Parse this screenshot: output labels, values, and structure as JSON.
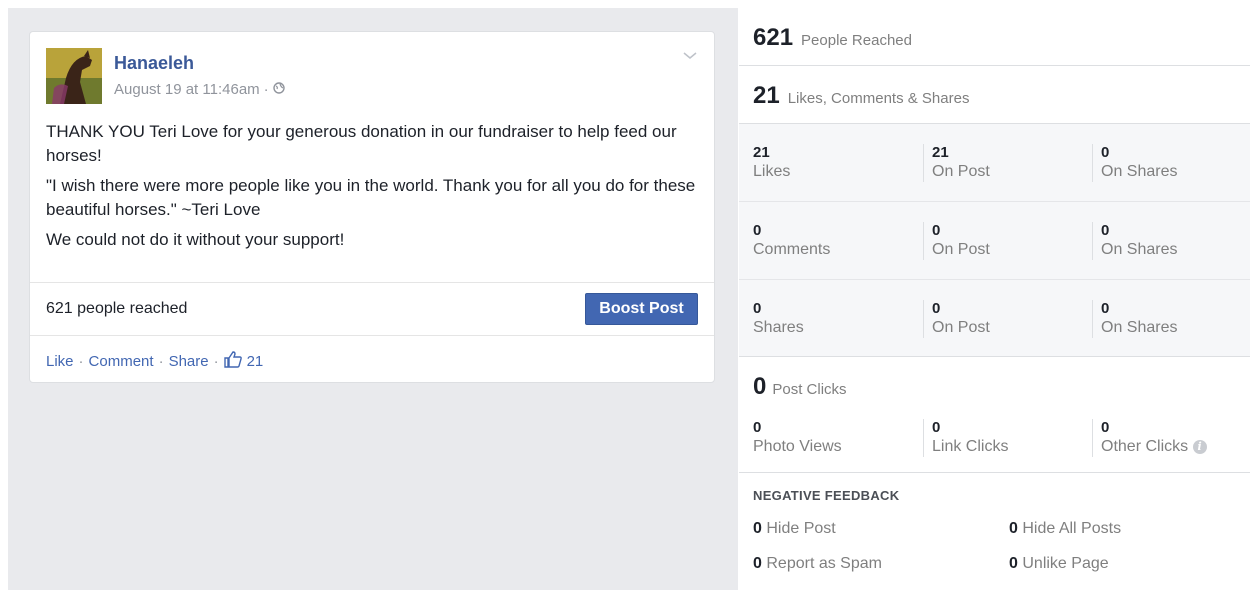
{
  "post": {
    "author": "Hanaeleh",
    "timestamp": "August 19 at 11:46am",
    "meta_sep": "·",
    "privacy_icon": "globe-icon",
    "body": [
      "THANK YOU Teri Love for your generous donation in our fundraiser to help feed our horses!",
      "\"I wish there were more people like you in the world. Thank you for all you do for these beautiful horses.\" ~Teri Love",
      "We could not do it without your support!"
    ],
    "reach_text": "621 people reached",
    "boost_label": "Boost Post",
    "actions": {
      "like": "Like",
      "comment": "Comment",
      "share": "Share",
      "sep": "·",
      "like_count": "21"
    }
  },
  "insights": {
    "people_reached": {
      "value": "621",
      "label": "People Reached"
    },
    "engagement": {
      "value": "21",
      "label": "Likes, Comments & Shares"
    },
    "rows": [
      {
        "cells": [
          {
            "value": "21",
            "label": "Likes"
          },
          {
            "value": "21",
            "label": "On Post"
          },
          {
            "value": "0",
            "label": "On Shares"
          }
        ]
      },
      {
        "cells": [
          {
            "value": "0",
            "label": "Comments"
          },
          {
            "value": "0",
            "label": "On Post"
          },
          {
            "value": "0",
            "label": "On Shares"
          }
        ]
      },
      {
        "cells": [
          {
            "value": "0",
            "label": "Shares"
          },
          {
            "value": "0",
            "label": "On Post"
          },
          {
            "value": "0",
            "label": "On Shares"
          }
        ]
      }
    ],
    "post_clicks": {
      "value": "0",
      "label": "Post Clicks"
    },
    "click_cells": [
      {
        "value": "0",
        "label": "Photo Views"
      },
      {
        "value": "0",
        "label": "Link Clicks"
      },
      {
        "value": "0",
        "label": "Other Clicks"
      }
    ],
    "negative_feedback": {
      "title": "NEGATIVE FEEDBACK",
      "items": [
        {
          "value": "0",
          "label": "Hide Post"
        },
        {
          "value": "0",
          "label": "Hide All Posts"
        },
        {
          "value": "0",
          "label": "Report as Spam"
        },
        {
          "value": "0",
          "label": "Unlike Page"
        }
      ]
    }
  },
  "colors": {
    "link": "#4267b2",
    "boost_bg": "#4267b2",
    "feed_bg": "#e9eaed"
  }
}
